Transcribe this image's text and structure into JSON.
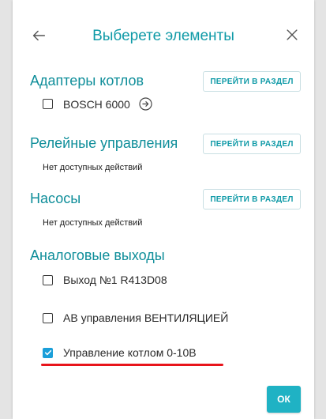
{
  "header": {
    "title": "Выберете элементы",
    "back_icon": "arrow-left-icon",
    "close_icon": "close-icon"
  },
  "sections": [
    {
      "title": "Адаптеры котлов",
      "goto_label": "ПЕРЕЙТИ В РАЗДЕЛ",
      "items": [
        {
          "label": "BOSCH 6000",
          "checked": false,
          "icon": "arrow-right-circle-icon"
        }
      ]
    },
    {
      "title": "Релейные управления",
      "goto_label": "ПЕРЕЙТИ В РАЗДЕЛ",
      "empty_note": "Нет доступных действий"
    },
    {
      "title": "Насосы",
      "goto_label": "ПЕРЕЙТИ В РАЗДЕЛ",
      "empty_note": "Нет доступных действий"
    },
    {
      "title": "Аналоговые выходы",
      "items": [
        {
          "label": "Выход №1 R413D08",
          "checked": false
        },
        {
          "label": "АВ управления ВЕНТИЛЯЦИЕЙ",
          "checked": false
        },
        {
          "label": "Управление котлом 0-10В",
          "checked": true
        }
      ]
    }
  ],
  "footer": {
    "ok_label": "ОК"
  },
  "colors": {
    "accent": "#0f9aa7",
    "checkbox_checked": "#1b9fd9",
    "highlight_underline": "#e8141b",
    "ok_button": "#1fb2c4"
  }
}
